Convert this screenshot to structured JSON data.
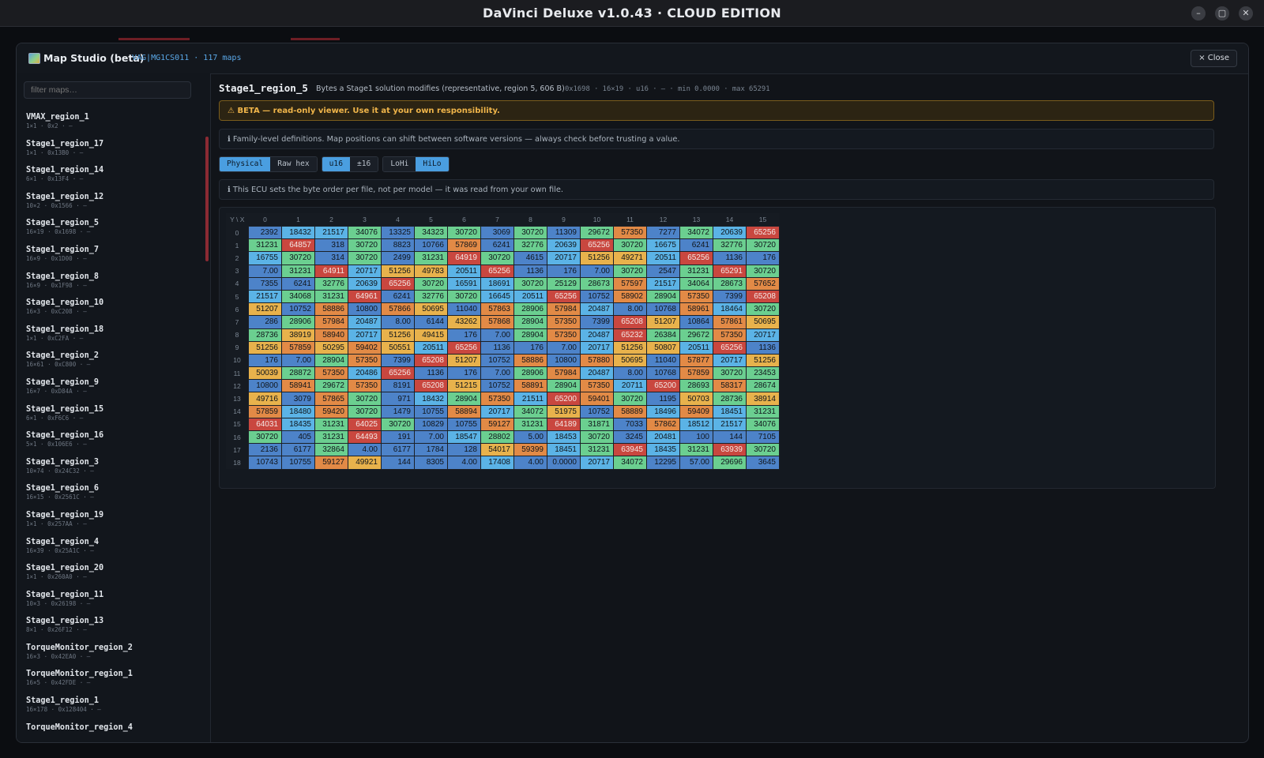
{
  "window": {
    "title": "DaVinci Deluxe v1.0.43  ·  CLOUD EDITION",
    "minimize": "–",
    "maximize": "▢",
    "close": "✕"
  },
  "modal": {
    "title": "Map Studio (beta)",
    "subtitle": "VAG|MG1CS011 · 117 maps",
    "close_label": "× Close"
  },
  "sidebar": {
    "filter_placeholder": "filter maps…",
    "maps": [
      {
        "name": "VMAX_region_1",
        "meta": "1×1 · 0x2 · —"
      },
      {
        "name": "Stage1_region_17",
        "meta": "1×1 · 0x13B0 · —"
      },
      {
        "name": "Stage1_region_14",
        "meta": "6×1 · 0x13F4 · —"
      },
      {
        "name": "Stage1_region_12",
        "meta": "10×2 · 0x1566 · —"
      },
      {
        "name": "Stage1_region_5",
        "meta": "16×19 · 0x1698 · —"
      },
      {
        "name": "Stage1_region_7",
        "meta": "16×9 · 0x1D00 · —"
      },
      {
        "name": "Stage1_region_8",
        "meta": "16×9 · 0x1F98 · —"
      },
      {
        "name": "Stage1_region_10",
        "meta": "16×3 · 0xC208 · —"
      },
      {
        "name": "Stage1_region_18",
        "meta": "1×1 · 0xC2FA · —"
      },
      {
        "name": "Stage1_region_2",
        "meta": "16×61 · 0xC800 · —"
      },
      {
        "name": "Stage1_region_9",
        "meta": "16×7 · 0xD84A · —"
      },
      {
        "name": "Stage1_region_15",
        "meta": "6×1 · 0xF6C6 · —"
      },
      {
        "name": "Stage1_region_16",
        "meta": "5×1 · 0x106E6 · —"
      },
      {
        "name": "Stage1_region_3",
        "meta": "10×74 · 0x24C32 · —"
      },
      {
        "name": "Stage1_region_6",
        "meta": "16×15 · 0x2561C · —"
      },
      {
        "name": "Stage1_region_19",
        "meta": "1×1 · 0x257AA · —"
      },
      {
        "name": "Stage1_region_4",
        "meta": "16×39 · 0x25A1C · —"
      },
      {
        "name": "Stage1_region_20",
        "meta": "1×1 · 0x260A0 · —"
      },
      {
        "name": "Stage1_region_11",
        "meta": "10×3 · 0x26198 · —"
      },
      {
        "name": "Stage1_region_13",
        "meta": "8×1 · 0x26F12 · —"
      },
      {
        "name": "TorqueMonitor_region_2",
        "meta": "16×3 · 0x42EA0 · —"
      },
      {
        "name": "TorqueMonitor_region_1",
        "meta": "16×5 · 0x42FDE · —"
      },
      {
        "name": "Stage1_region_1",
        "meta": "16×178 · 0x128404 · —"
      },
      {
        "name": "TorqueMonitor_region_4",
        "meta": ""
      }
    ]
  },
  "main": {
    "map_name": "Stage1_region_5",
    "description": "Bytes a Stage1 solution modifies (representative, region 5, 606 B)",
    "stats": "0x1698 · 16×19 · u16 · – · min 0.0000 · max 65291",
    "beta_warning": "⚠ BETA — read-only viewer. Use it at your own responsibility.",
    "info_family": "ℹ Family-level definitions. Map positions can shift between software versions — always check before trusting a value.",
    "info_byteorder": "ℹ This ECU sets the byte order per file, not per model — it was read from your own file.",
    "toggles": [
      [
        {
          "label": "Physical",
          "active": true
        },
        {
          "label": "Raw hex",
          "active": false
        }
      ],
      [
        {
          "label": "u16",
          "active": true
        },
        {
          "label": "±16",
          "active": false
        }
      ],
      [
        {
          "label": "LoHi",
          "active": false
        },
        {
          "label": "HiLo",
          "active": true
        }
      ]
    ],
    "colors": {
      "low": "#4d83c9",
      "mid_low": "#5bb3e6",
      "mid": "#6bcf90",
      "mid_high": "#e8b24c",
      "high": "#e28a46",
      "max": "#c9473f"
    }
  },
  "table": {
    "corner": "Y \\ X",
    "columns": [
      "0",
      "1",
      "2",
      "3",
      "4",
      "5",
      "6",
      "7",
      "8",
      "9",
      "10",
      "11",
      "12",
      "13",
      "14",
      "15"
    ],
    "rows": [
      {
        "y": "0",
        "cells": [
          "2392",
          "18432",
          "21517",
          "34076",
          "13325",
          "34323",
          "30720",
          "3069",
          "30720",
          "11309",
          "29672",
          "57350",
          "7277",
          "34072",
          "20639",
          "65256"
        ],
        "levels": [
          0,
          1,
          1,
          2,
          0,
          2,
          2,
          0,
          2,
          0,
          2,
          4,
          0,
          2,
          1,
          5
        ]
      },
      {
        "y": "1",
        "cells": [
          "31231",
          "64857",
          "318",
          "30720",
          "8823",
          "10766",
          "57869",
          "6241",
          "32776",
          "20639",
          "65256",
          "30720",
          "16675",
          "6241",
          "32776",
          "30720"
        ],
        "levels": [
          2,
          5,
          0,
          2,
          0,
          0,
          4,
          0,
          2,
          1,
          5,
          2,
          1,
          0,
          2,
          2
        ]
      },
      {
        "y": "2",
        "cells": [
          "16755",
          "30720",
          "314",
          "30720",
          "2499",
          "31231",
          "64919",
          "30720",
          "4615",
          "20717",
          "51256",
          "49271",
          "20511",
          "65256",
          "1136",
          "176"
        ],
        "levels": [
          1,
          2,
          0,
          2,
          0,
          2,
          5,
          2,
          0,
          1,
          3,
          3,
          1,
          5,
          0,
          0
        ]
      },
      {
        "y": "3",
        "cells": [
          "7.00",
          "31231",
          "64911",
          "20717",
          "51256",
          "49783",
          "20511",
          "65256",
          "1136",
          "176",
          "7.00",
          "30720",
          "2547",
          "31231",
          "65291",
          "30720"
        ],
        "levels": [
          0,
          2,
          5,
          1,
          3,
          3,
          1,
          5,
          0,
          0,
          0,
          2,
          0,
          2,
          5,
          2
        ]
      },
      {
        "y": "4",
        "cells": [
          "7355",
          "6241",
          "32776",
          "20639",
          "65256",
          "30720",
          "16591",
          "18691",
          "30720",
          "25129",
          "28673",
          "57597",
          "21517",
          "34064",
          "28673",
          "57652"
        ],
        "levels": [
          0,
          0,
          2,
          1,
          5,
          2,
          1,
          1,
          2,
          2,
          2,
          4,
          1,
          2,
          2,
          4
        ]
      },
      {
        "y": "5",
        "cells": [
          "21517",
          "34068",
          "31231",
          "64961",
          "6241",
          "32776",
          "30720",
          "16645",
          "20511",
          "65256",
          "10752",
          "58902",
          "28904",
          "57350",
          "7399",
          "65208"
        ],
        "levels": [
          1,
          2,
          2,
          5,
          0,
          2,
          2,
          1,
          1,
          5,
          0,
          4,
          2,
          4,
          0,
          5
        ]
      },
      {
        "y": "6",
        "cells": [
          "51207",
          "10752",
          "58886",
          "10800",
          "57866",
          "50695",
          "11040",
          "57863",
          "28906",
          "57984",
          "20487",
          "8.00",
          "10768",
          "58961",
          "18464",
          "30720"
        ],
        "levels": [
          3,
          0,
          4,
          0,
          4,
          3,
          0,
          4,
          2,
          4,
          1,
          0,
          0,
          4,
          1,
          2
        ]
      },
      {
        "y": "7",
        "cells": [
          "286",
          "28906",
          "57984",
          "20487",
          "8.00",
          "6144",
          "43262",
          "57868",
          "28904",
          "57350",
          "7399",
          "65208",
          "51207",
          "10864",
          "57861",
          "50695"
        ],
        "levels": [
          0,
          2,
          4,
          1,
          0,
          0,
          3,
          4,
          2,
          4,
          0,
          5,
          3,
          0,
          4,
          3
        ]
      },
      {
        "y": "8",
        "cells": [
          "28736",
          "38919",
          "58940",
          "20717",
          "51256",
          "49415",
          "176",
          "7.00",
          "28904",
          "57350",
          "20487",
          "65232",
          "26384",
          "29672",
          "57350",
          "20717"
        ],
        "levels": [
          2,
          3,
          4,
          1,
          3,
          3,
          0,
          0,
          2,
          4,
          1,
          5,
          2,
          2,
          4,
          1
        ]
      },
      {
        "y": "9",
        "cells": [
          "51256",
          "57859",
          "50295",
          "59402",
          "50551",
          "20511",
          "65256",
          "1136",
          "176",
          "7.00",
          "20717",
          "51256",
          "50807",
          "20511",
          "65256",
          "1136"
        ],
        "levels": [
          3,
          4,
          3,
          4,
          3,
          1,
          5,
          0,
          0,
          0,
          1,
          3,
          3,
          1,
          5,
          0
        ]
      },
      {
        "y": "10",
        "cells": [
          "176",
          "7.00",
          "28904",
          "57350",
          "7399",
          "65208",
          "51207",
          "10752",
          "58886",
          "10800",
          "57880",
          "50695",
          "11040",
          "57877",
          "20717",
          "51256"
        ],
        "levels": [
          0,
          0,
          2,
          4,
          0,
          5,
          3,
          0,
          4,
          0,
          4,
          3,
          0,
          4,
          1,
          3
        ]
      },
      {
        "y": "11",
        "cells": [
          "50039",
          "28872",
          "57350",
          "20486",
          "65256",
          "1136",
          "176",
          "7.00",
          "28906",
          "57984",
          "20487",
          "8.00",
          "10768",
          "57859",
          "30720",
          "23453"
        ],
        "levels": [
          3,
          2,
          4,
          1,
          5,
          0,
          0,
          0,
          2,
          4,
          1,
          0,
          0,
          4,
          2,
          2
        ]
      },
      {
        "y": "12",
        "cells": [
          "10800",
          "58941",
          "29672",
          "57350",
          "8191",
          "65208",
          "51215",
          "10752",
          "58891",
          "28904",
          "57350",
          "20711",
          "65200",
          "28693",
          "58317",
          "28674"
        ],
        "levels": [
          0,
          4,
          2,
          4,
          0,
          5,
          3,
          0,
          4,
          2,
          4,
          1,
          5,
          2,
          4,
          2
        ]
      },
      {
        "y": "13",
        "cells": [
          "49716",
          "3079",
          "57865",
          "30720",
          "971",
          "18432",
          "28904",
          "57350",
          "21511",
          "65200",
          "59401",
          "30720",
          "1195",
          "50703",
          "28736",
          "38914"
        ],
        "levels": [
          3,
          0,
          4,
          2,
          0,
          1,
          2,
          4,
          1,
          5,
          4,
          2,
          0,
          3,
          2,
          3
        ]
      },
      {
        "y": "14",
        "cells": [
          "57859",
          "18480",
          "59420",
          "30720",
          "1479",
          "10755",
          "58894",
          "20717",
          "34072",
          "51975",
          "10752",
          "58889",
          "18496",
          "59409",
          "18451",
          "31231"
        ],
        "levels": [
          4,
          1,
          4,
          2,
          0,
          0,
          4,
          1,
          2,
          3,
          0,
          4,
          1,
          4,
          1,
          2
        ]
      },
      {
        "y": "15",
        "cells": [
          "64031",
          "18435",
          "31231",
          "64025",
          "30720",
          "10829",
          "10755",
          "59127",
          "31231",
          "64189",
          "31871",
          "7033",
          "57862",
          "18512",
          "21517",
          "34076"
        ],
        "levels": [
          5,
          1,
          2,
          5,
          2,
          0,
          0,
          4,
          2,
          5,
          2,
          0,
          4,
          1,
          1,
          2
        ]
      },
      {
        "y": "16",
        "cells": [
          "30720",
          "405",
          "31231",
          "64493",
          "191",
          "7.00",
          "18547",
          "28802",
          "5.00",
          "18453",
          "30720",
          "3245",
          "20481",
          "100",
          "144",
          "7105"
        ],
        "levels": [
          2,
          0,
          2,
          5,
          0,
          0,
          1,
          2,
          0,
          1,
          2,
          0,
          1,
          0,
          0,
          0
        ]
      },
      {
        "y": "17",
        "cells": [
          "2136",
          "6177",
          "32864",
          "4.00",
          "6177",
          "1784",
          "128",
          "54017",
          "59399",
          "18451",
          "31231",
          "63945",
          "18435",
          "31231",
          "63939",
          "30720"
        ],
        "levels": [
          0,
          0,
          2,
          0,
          0,
          0,
          0,
          3,
          4,
          1,
          2,
          5,
          1,
          2,
          5,
          2
        ]
      },
      {
        "y": "18",
        "cells": [
          "10743",
          "10755",
          "59127",
          "49921",
          "144",
          "8305",
          "4.00",
          "17408",
          "4.00",
          "0.0000",
          "20717",
          "34072",
          "12295",
          "57.00",
          "29696",
          "3645"
        ],
        "levels": [
          0,
          0,
          4,
          3,
          0,
          0,
          0,
          1,
          0,
          0,
          1,
          2,
          0,
          0,
          2,
          0
        ]
      }
    ]
  }
}
